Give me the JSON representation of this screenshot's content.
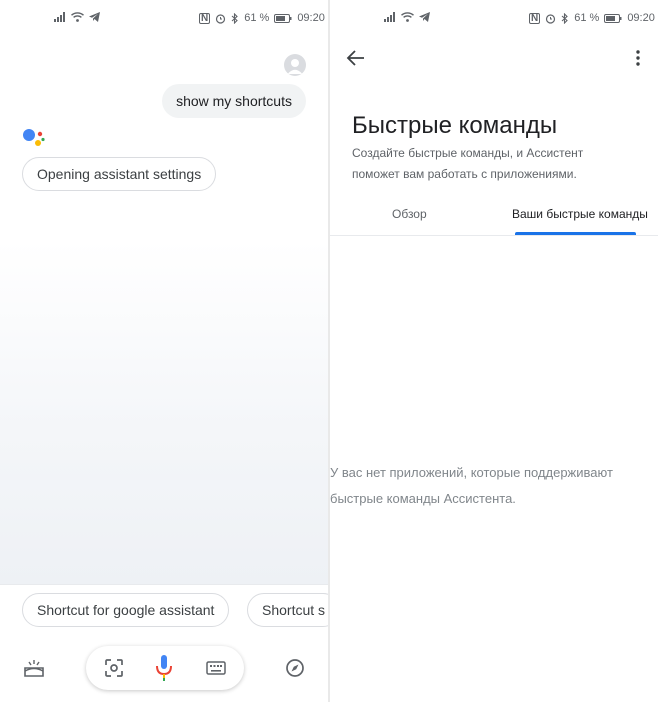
{
  "left_status": {
    "battery_percent": "61 %",
    "time": "09:20"
  },
  "right_status": {
    "battery_percent": "61 %",
    "time": "09:20"
  },
  "conversation": {
    "user_query": "show my shortcuts",
    "assistant_reply": "Opening assistant settings"
  },
  "suggestion_chips": [
    "Shortcut for google assistant",
    "Shortcut s"
  ],
  "settings": {
    "title": "Быстрые команды",
    "subtitle_line1": "Создайте быстрые команды, и Ассистент",
    "subtitle_line2": "поможет вам работать с приложениями.",
    "tabs": [
      {
        "label": "Обзор",
        "active": false
      },
      {
        "label": "Ваши быстрые команды",
        "active": true
      }
    ],
    "empty_line1": "У вас нет приложений, которые поддерживают",
    "empty_line2": "быстрые команды Ассистента."
  },
  "icons": {
    "status_left": [
      "signal-icon",
      "wifi-icon",
      "telegram-icon"
    ],
    "status_right": [
      "nfc-icon",
      "alarm-icon",
      "bluetooth-icon",
      "battery-icon"
    ],
    "bottom_bar": [
      "snapshot-icon",
      "lens-icon",
      "mic-icon",
      "keyboard-icon",
      "explore-icon"
    ]
  },
  "colors": {
    "google_blue": "#4285F4",
    "google_red": "#EA4335",
    "google_yellow": "#FBBC05",
    "google_green": "#34A853",
    "tab_accent": "#1a73e8"
  }
}
